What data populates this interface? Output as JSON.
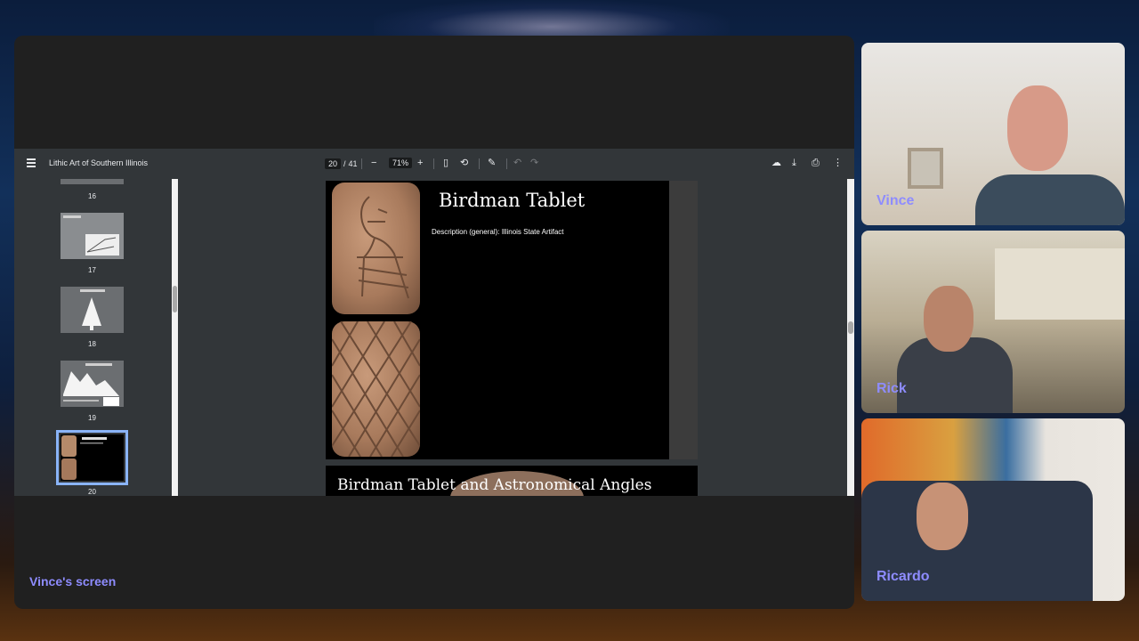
{
  "pdf": {
    "title": "Lithic Art of Southern Illinois",
    "page_current": "20",
    "page_separator": "/",
    "page_total": "41",
    "zoom": "71%"
  },
  "thumbnails": [
    {
      "number": "16"
    },
    {
      "number": "17"
    },
    {
      "number": "18"
    },
    {
      "number": "19"
    },
    {
      "number": "20",
      "selected": true
    }
  ],
  "slide": {
    "title": "Birdman Tablet",
    "description": "Description (general): Illinois State Artifact"
  },
  "next_slide": {
    "title": "Birdman Tablet and Astronomical Angles"
  },
  "screen_share": {
    "label": "Vince's screen"
  },
  "participants": [
    {
      "name": "Vince"
    },
    {
      "name": "Rick"
    },
    {
      "name": "Ricardo"
    }
  ],
  "colors": {
    "participant_name": "#8e8cff",
    "toolbar": "#323639",
    "selected_thumbnail": "#8ab4f8"
  }
}
